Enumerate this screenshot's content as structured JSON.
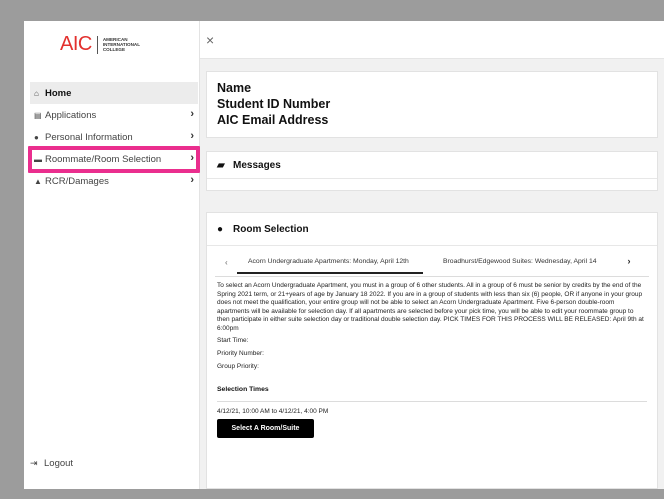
{
  "brand": {
    "logo_mark": "AIC",
    "logo_lines": [
      "American",
      "International",
      "College"
    ]
  },
  "sidebar": {
    "items": [
      {
        "label": "Home",
        "icon": "home-icon",
        "active": true
      },
      {
        "label": "Applications",
        "icon": "clipboard-icon"
      },
      {
        "label": "Personal Information",
        "icon": "person-icon"
      },
      {
        "label": "Roommate/Room Selection",
        "icon": "bed-icon"
      },
      {
        "label": "RCR/Damages",
        "icon": "warning-icon"
      }
    ],
    "logout_label": "Logout",
    "highlight_color": "#ea2e8e"
  },
  "header": {
    "close_glyph": "×"
  },
  "student": {
    "name_label": "Name",
    "id_label": "Student ID Number",
    "email_label": "AIC Email Address"
  },
  "messages": {
    "title": "Messages"
  },
  "room_selection": {
    "title": "Room Selection",
    "tabs": [
      "Acorn Undergraduate Apartments: Monday, April 12th",
      "Broadhurst/Edgewood Suites: Wednesday, April 14"
    ],
    "description": "To select an Acorn Undergraduate Apartment, you must in a group of 6 other students. All in a group of 6 must be senior by credits by the end of the Spring 2021 term, or 21+years of age by January 18 2022. If you are in a group of students with less than six (6) people, OR if anyone in your group does not meet the qualification, your entire group will not be able to select an Acorn Undergraduate Apartment. Five 6-person double-room apartments will be available for selection day. If all apartments are selected before your pick time, you will be able to edit your roommate group to then participate in either suite selection day or traditional double selection day. PICK TIMES FOR THIS PROCESS WILL BE RELEASED: April 9th at 6:00pm",
    "start_time_label": "Start Time:",
    "priority_number_label": "Priority Number:",
    "group_priority_label": "Group Priority:",
    "selection_times_label": "Selection Times",
    "selection_time_value": "4/12/21, 10:00 AM to 4/12/21, 4:00 PM",
    "select_button_label": "Select A Room/Suite"
  }
}
